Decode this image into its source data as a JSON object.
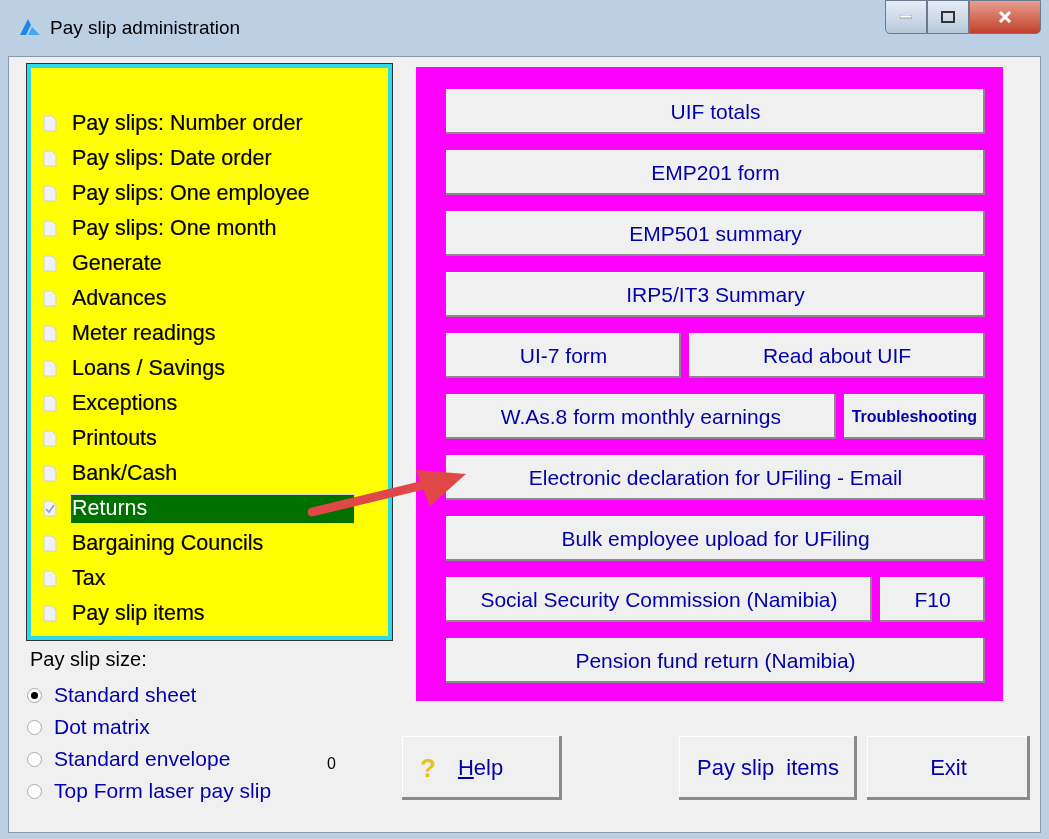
{
  "window": {
    "title": "Pay slip administration"
  },
  "menu": [
    {
      "label": "Pay slips: Number order",
      "selected": false
    },
    {
      "label": "Pay slips: Date order",
      "selected": false
    },
    {
      "label": "Pay slips: One employee",
      "selected": false
    },
    {
      "label": "Pay slips: One month",
      "selected": false
    },
    {
      "label": "Generate",
      "selected": false
    },
    {
      "label": "Advances",
      "selected": false
    },
    {
      "label": "Meter readings",
      "selected": false
    },
    {
      "label": "Loans / Savings",
      "selected": false
    },
    {
      "label": "Exceptions",
      "selected": false
    },
    {
      "label": "Printouts",
      "selected": false
    },
    {
      "label": "Bank/Cash",
      "selected": false
    },
    {
      "label": "Returns",
      "selected": true
    },
    {
      "label": "Bargaining Councils",
      "selected": false
    },
    {
      "label": "Tax",
      "selected": false
    },
    {
      "label": "Pay slip items",
      "selected": false
    }
  ],
  "size": {
    "label": "Pay slip size:",
    "options": [
      {
        "label": "Standard sheet",
        "selected": true
      },
      {
        "label": "Dot matrix",
        "selected": false
      },
      {
        "label": "Standard envelope",
        "selected": false
      },
      {
        "label": "Top Form laser pay slip",
        "selected": false
      }
    ],
    "counter": "0"
  },
  "returns_buttons": [
    [
      {
        "label": "UIF totals",
        "kind": "normal"
      }
    ],
    [
      {
        "label": "EMP201 form",
        "kind": "normal"
      }
    ],
    [
      {
        "label": "EMP501 summary",
        "kind": "normal"
      }
    ],
    [
      {
        "label": "IRP5/IT3 Summary",
        "kind": "normal"
      }
    ],
    [
      {
        "label": "UI-7 form",
        "kind": "normal"
      },
      {
        "label": "Read about UIF",
        "kind": "normal"
      }
    ],
    [
      {
        "label": "W.As.8 form monthly earnings",
        "kind": "normal"
      },
      {
        "label": "Troubleshooting",
        "kind": "small"
      }
    ],
    [
      {
        "label": "Electronic declaration for UFiling - Email",
        "kind": "normal"
      }
    ],
    [
      {
        "label": "Bulk employee upload for UFiling",
        "kind": "normal"
      }
    ],
    [
      {
        "label": "Social Security Commission (Namibia)",
        "kind": "normal"
      },
      {
        "label": "F10",
        "kind": "normal"
      }
    ],
    [
      {
        "label": "Pension fund return (Namibia)",
        "kind": "normal"
      }
    ]
  ],
  "footer": {
    "help": {
      "icon": "?",
      "label": "Help",
      "mnemonic_underlined": true
    },
    "items": "Pay slip  items",
    "exit": "Exit"
  }
}
